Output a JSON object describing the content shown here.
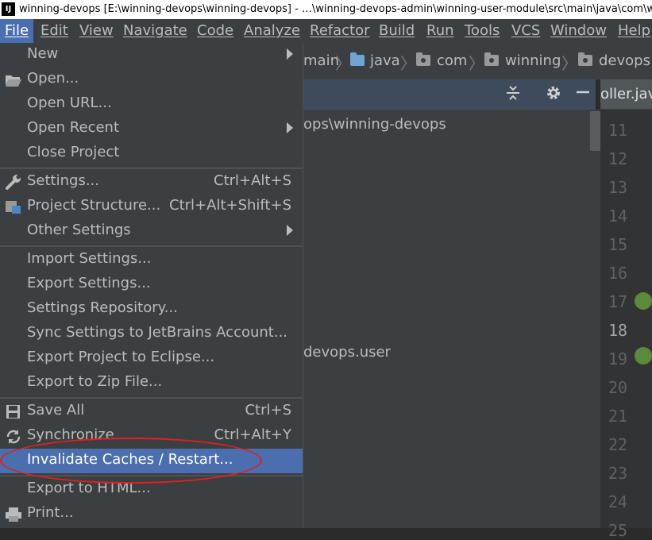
{
  "window": {
    "title": "winning-devops [E:\\winning-devops\\winning-devops] - …\\winning-devops-admin\\winning-user-module\\src\\main\\java\\com\\winning\\devops",
    "app_icon_text": "IJ"
  },
  "menubar": {
    "items": [
      {
        "label": "File"
      },
      {
        "label": "Edit"
      },
      {
        "label": "View"
      },
      {
        "label": "Navigate"
      },
      {
        "label": "Code"
      },
      {
        "label": "Analyze"
      },
      {
        "label": "Refactor"
      },
      {
        "label": "Build"
      },
      {
        "label": "Run"
      },
      {
        "label": "Tools"
      },
      {
        "label": "VCS"
      },
      {
        "label": "Window"
      },
      {
        "label": "Help"
      }
    ]
  },
  "breadcrumb": {
    "items": [
      {
        "label": "main"
      },
      {
        "label": "java"
      },
      {
        "label": "com"
      },
      {
        "label": "winning"
      },
      {
        "label": "devops"
      }
    ]
  },
  "project_panel": {
    "path_text": "ops\\winning-devops",
    "package_text": "devops.user"
  },
  "editor": {
    "tab_label": "oller.java",
    "line_numbers": [
      "11",
      "12",
      "13",
      "14",
      "15",
      "16",
      "17",
      "18",
      "19",
      "20",
      "21",
      "22",
      "23",
      "24",
      "25"
    ],
    "current_line": "18"
  },
  "file_menu": {
    "items": [
      {
        "label": "New",
        "shortcut": "",
        "submenu": true,
        "icon": ""
      },
      {
        "label": "Open...",
        "shortcut": "",
        "submenu": false,
        "icon": "folder-open-icon"
      },
      {
        "label": "Open URL...",
        "shortcut": "",
        "submenu": false,
        "icon": ""
      },
      {
        "label": "Open Recent",
        "shortcut": "",
        "submenu": true,
        "icon": ""
      },
      {
        "label": "Close Project",
        "shortcut": "",
        "submenu": false,
        "icon": ""
      },
      {
        "label": "Settings...",
        "shortcut": "Ctrl+Alt+S",
        "submenu": false,
        "icon": "wrench-icon"
      },
      {
        "label": "Project Structure...",
        "shortcut": "Ctrl+Alt+Shift+S",
        "submenu": false,
        "icon": "project-structure-icon"
      },
      {
        "label": "Other Settings",
        "shortcut": "",
        "submenu": true,
        "icon": ""
      },
      {
        "label": "Import Settings...",
        "shortcut": "",
        "submenu": false,
        "icon": ""
      },
      {
        "label": "Export Settings...",
        "shortcut": "",
        "submenu": false,
        "icon": ""
      },
      {
        "label": "Settings Repository...",
        "shortcut": "",
        "submenu": false,
        "icon": ""
      },
      {
        "label": "Sync Settings to JetBrains Account...",
        "shortcut": "",
        "submenu": false,
        "icon": ""
      },
      {
        "label": "Export Project to Eclipse...",
        "shortcut": "",
        "submenu": false,
        "icon": ""
      },
      {
        "label": "Export to Zip File...",
        "shortcut": "",
        "submenu": false,
        "icon": ""
      },
      {
        "label": "Save All",
        "shortcut": "Ctrl+S",
        "submenu": false,
        "icon": "save-icon"
      },
      {
        "label": "Synchronize",
        "shortcut": "Ctrl+Alt+Y",
        "submenu": false,
        "icon": "sync-icon"
      },
      {
        "label": "Invalidate Caches / Restart...",
        "shortcut": "",
        "submenu": false,
        "icon": "",
        "highlighted": true
      },
      {
        "label": "Export to HTML...",
        "shortcut": "",
        "submenu": false,
        "icon": ""
      },
      {
        "label": "Print...",
        "shortcut": "",
        "submenu": false,
        "icon": "printer-icon"
      }
    ]
  },
  "colors": {
    "menu_bg": "#3c3f41",
    "highlight": "#4b6eaf",
    "annotation": "#e02020",
    "editor_bg": "#2b2b2b"
  }
}
